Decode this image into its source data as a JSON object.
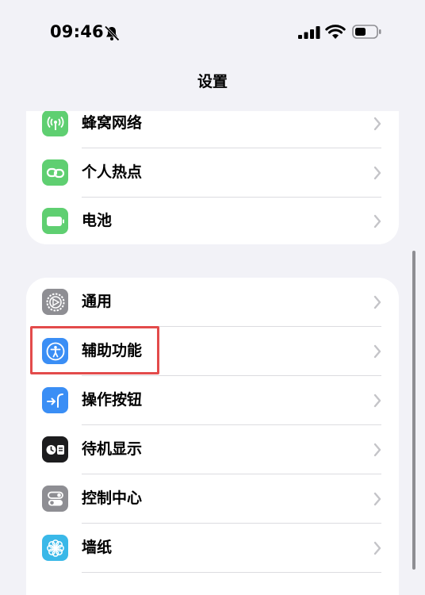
{
  "status_bar": {
    "time": "09:46"
  },
  "nav": {
    "title": "设置"
  },
  "group_top": {
    "items": [
      {
        "label": "蜂窝网络",
        "icon": "cellular-antenna-icon",
        "color": "#5fcf71"
      },
      {
        "label": "个人热点",
        "icon": "hotspot-link-icon",
        "color": "#5fcf71"
      },
      {
        "label": "电池",
        "icon": "battery-icon",
        "color": "#5fcf71"
      }
    ]
  },
  "group_main": {
    "items": [
      {
        "label": "通用",
        "icon": "gear-icon",
        "color": "#8e8e93"
      },
      {
        "label": "辅助功能",
        "icon": "accessibility-icon",
        "color": "#3a8ef5"
      },
      {
        "label": "操作按钮",
        "icon": "action-button-icon",
        "color": "#3a8ef5"
      },
      {
        "label": "待机显示",
        "icon": "standby-icon",
        "color": "#1c1c1e"
      },
      {
        "label": "控制中心",
        "icon": "toggles-icon",
        "color": "#8e8e93"
      },
      {
        "label": "墙纸",
        "icon": "flower-icon",
        "color": "#3ab8e8"
      }
    ]
  },
  "colors": {
    "background": "#f2f2f7",
    "highlight": "#e34b4b",
    "separator": "#dcdce0",
    "chevron": "#c4c4c8"
  }
}
